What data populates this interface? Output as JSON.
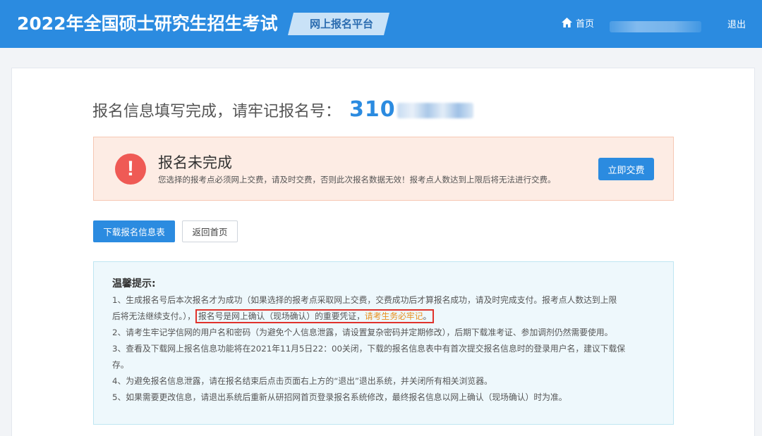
{
  "header": {
    "site_title": "2022年全国硕士研究生招生考试",
    "platform_tag": "网上报名平台",
    "nav_home": "首页",
    "logout": "退出",
    "home_icon": "home-icon"
  },
  "headline": {
    "label": "报名信息填写完成，请牢记报名号：",
    "number_prefix": "310"
  },
  "alert": {
    "icon": "exclamation-icon",
    "title": "报名未完成",
    "text": "您选择的报考点必须网上交费，请及时交费，否则此次报名数据无效！报考点人数达到上限后将无法进行交费。",
    "pay_button": "立即交费"
  },
  "actions": {
    "download_button": "下载报名信息表",
    "home_button": "返回首页"
  },
  "tips": {
    "title": "温馨提示:",
    "line1": "1、生成报名号后本次报名才为成功（如果选择的报考点采取网上交费，交费成功后才算报名成功，请及时完成支付。报考点人数达到上限",
    "line2_prefix": "后将无法继续支付。），",
    "line2_boxed": "报名号是网上确认（现场确认）的重要凭证，",
    "line2_boxed_orange": "请考生务必牢记",
    "line2_boxed_end": "。",
    "line3": "2、请考生牢记学信网的用户名和密码（为避免个人信息泄露，请设置复杂密码并定期修改），后期下载准考证、参加调剂仍然需要使用。",
    "line4": "3、查看及下载网上报名信息功能将在2021年11月5日22：00关闭，下载的报名信息表中有首次提交报名信息时的登录用户名，建议下载保",
    "line5": "存。",
    "line6": "4、为避免报名信息泄露，请在报名结束后点击页面右上方的“退出”退出系统，并关闭所有相关浏览器。",
    "line7": "5、如果需要更改信息，请退出系统后重新从研招网首页登录报名系统修改，最终报名信息以网上确认（现场确认）时为准。"
  },
  "colors": {
    "brand_blue": "#2b8be0",
    "alert_bg": "#fdece4",
    "alert_icon": "#ef5a55",
    "tips_bg": "#eef8fc",
    "highlight_border": "#e0332c",
    "warning_orange": "#e8901e"
  }
}
